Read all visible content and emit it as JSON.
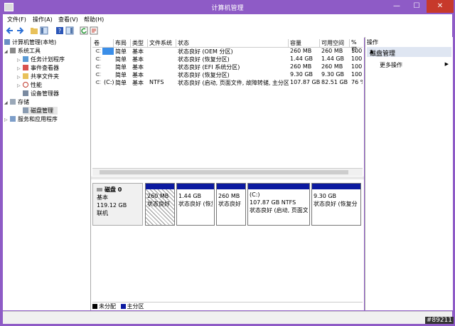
{
  "window": {
    "title": "计算机管理",
    "minimize": "—",
    "maximize": "☐",
    "close": "✕"
  },
  "menu": [
    "文件(F)",
    "操作(A)",
    "查看(V)",
    "帮助(H)"
  ],
  "tree": {
    "root": "计算机管理(本地)",
    "system_tools": "系统工具",
    "task_scheduler": "任务计划程序",
    "event_viewer": "事件查看器",
    "shared_folders": "共享文件夹",
    "performance": "性能",
    "device_manager": "设备管理器",
    "storage": "存储",
    "disk_management": "磁盘管理",
    "services": "服务和应用程序"
  },
  "volumes": {
    "headers": [
      "卷",
      "布局",
      "类型",
      "文件系统",
      "状态",
      "容量",
      "可用空间",
      "% 可"
    ],
    "rows": [
      [
        "",
        "简单",
        "基本",
        "",
        "状态良好 (OEM 分区)",
        "260 MB",
        "260 MB",
        "100"
      ],
      [
        "",
        "简单",
        "基本",
        "",
        "状态良好 (恢复分区)",
        "1.44 GB",
        "1.44 GB",
        "100"
      ],
      [
        "",
        "简单",
        "基本",
        "",
        "状态良好 (EFI 系统分区)",
        "260 MB",
        "260 MB",
        "100"
      ],
      [
        "",
        "简单",
        "基本",
        "",
        "状态良好 (恢复分区)",
        "9.30 GB",
        "9.30 GB",
        "100"
      ],
      [
        "(C:)",
        "简单",
        "基本",
        "NTFS",
        "状态良好 (启动, 页面文件, 故障转储, 主分区)",
        "107.87 GB",
        "82.51 GB",
        "76 %"
      ]
    ]
  },
  "disk": {
    "name": "磁盘 0",
    "type": "基本",
    "size": "119.12 GB",
    "status": "联机",
    "partitions": [
      {
        "label": "",
        "size": "260 MB",
        "status": "状态良好"
      },
      {
        "label": "",
        "size": "1.44 GB",
        "status": "状态良好 (恢复"
      },
      {
        "label": "",
        "size": "260 MB",
        "status": "状态良好"
      },
      {
        "label": "(C:)",
        "size": "107.87 GB NTFS",
        "status": "状态良好 (启动, 页面文"
      },
      {
        "label": "",
        "size": "9.30 GB",
        "status": "状态良好 (恢复分"
      }
    ]
  },
  "legend": {
    "unallocated": "未分配",
    "primary": "主分区"
  },
  "actions": {
    "header": "操作",
    "group": "磁盘管理",
    "more": "更多操作"
  },
  "colors": {
    "primary": "#0c1aa0",
    "unallocated": "#000000",
    "accent": "#8e5bc6"
  },
  "watermark": "#89211"
}
